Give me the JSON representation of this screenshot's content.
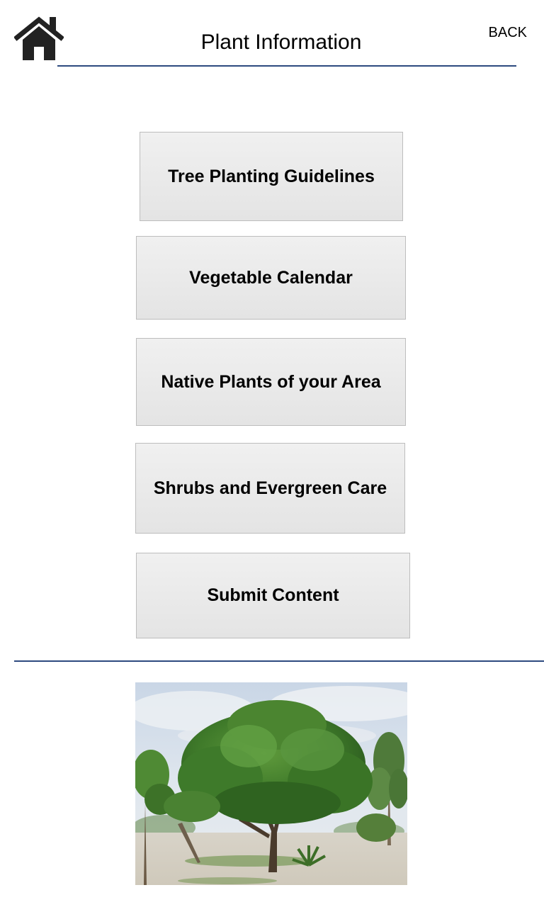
{
  "header": {
    "title": "Plant Information",
    "back_label": "BACK",
    "home_icon": "home-icon"
  },
  "menu": {
    "items": [
      {
        "label": "Tree Planting Guidelines"
      },
      {
        "label": "Vegetable Calendar"
      },
      {
        "label": "Native Plants of your Area"
      },
      {
        "label": "Shrubs and Evergreen Care"
      },
      {
        "label": "Submit Content"
      }
    ]
  },
  "colors": {
    "rule": "#2d4a7f",
    "button_bg": "#e9e9e9",
    "button_border": "#bdbdbd"
  },
  "footer": {
    "image": "tree-photo"
  }
}
